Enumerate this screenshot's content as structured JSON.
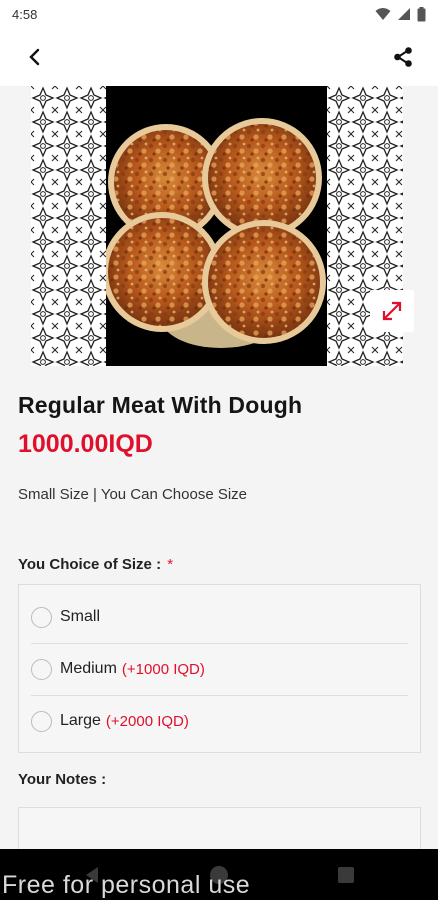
{
  "status_bar": {
    "time": "4:58"
  },
  "product": {
    "name": "Regular Meat With Dough",
    "price": "1000.00IQD",
    "description": "Small Size | You Can Choose Size"
  },
  "size_choice": {
    "label": "You Choice of Size :",
    "required_mark": "*",
    "options": [
      {
        "label": "Small",
        "extra": ""
      },
      {
        "label": "Medium",
        "extra": "(+1000 IQD)"
      },
      {
        "label": "Large",
        "extra": "(+2000 IQD)"
      }
    ]
  },
  "notes": {
    "label": "Your Notes :"
  },
  "watermark": "Free for personal use",
  "colors": {
    "accent": "#e0102d",
    "background": "#f4f4f4"
  },
  "icons": [
    "back-arrow-icon",
    "share-icon",
    "expand-icon",
    "wifi-icon",
    "signal-icon",
    "battery-icon"
  ]
}
